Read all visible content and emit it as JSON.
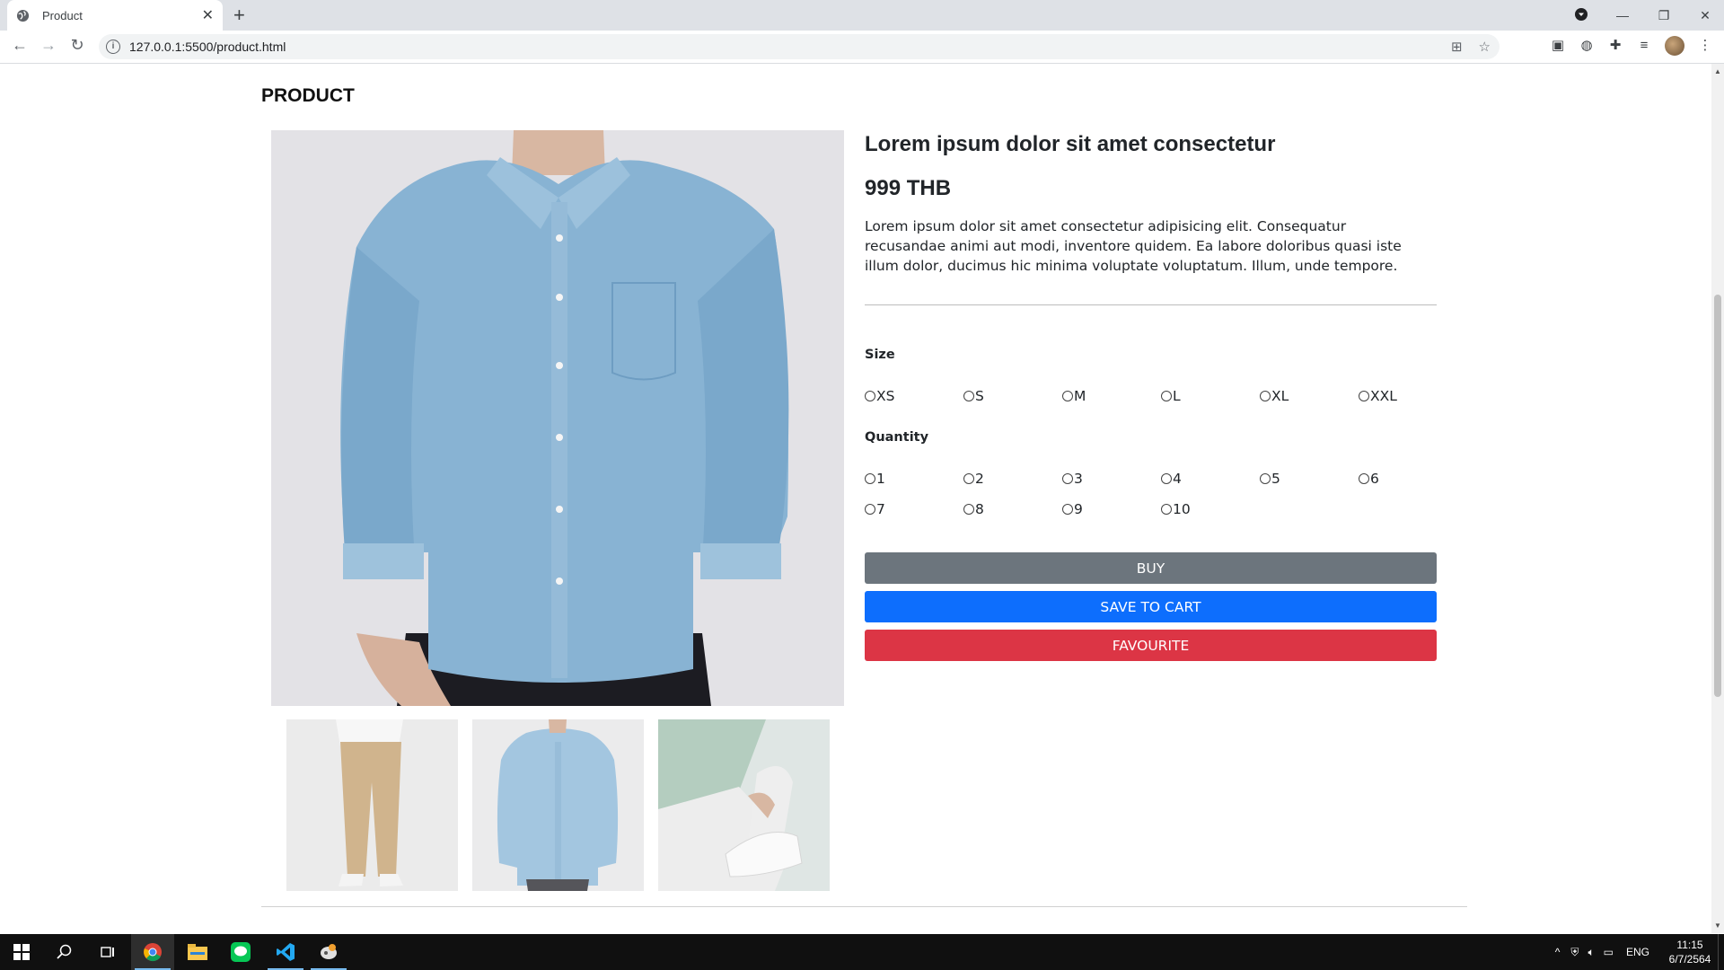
{
  "browser": {
    "tab_title": "Product",
    "tab_close": "✕",
    "new_tab": "+",
    "url": "127.0.0.1:5500/product.html",
    "window_controls": {
      "minimize": "—",
      "restore": "❐",
      "close": "✕"
    }
  },
  "page": {
    "heading": "PRODUCT",
    "product": {
      "title": "Lorem ipsum dolor sit amet consectetur",
      "price": "999 THB",
      "description": "Lorem ipsum dolor sit amet consectetur adipisicing elit. Consequatur recusandae animi aut modi, inventore quidem. Ea labore doloribus quasi iste illum dolor, ducimus hic minima voluptate voluptatum. Illum, unde tempore."
    },
    "size": {
      "label": "Size",
      "options": [
        "XS",
        "S",
        "M",
        "L",
        "XL",
        "XXL"
      ]
    },
    "quantity": {
      "label": "Quantity",
      "options": [
        "1",
        "2",
        "3",
        "4",
        "5",
        "6",
        "7",
        "8",
        "9",
        "10"
      ]
    },
    "buttons": {
      "buy": "BUY",
      "save_to_cart": "SAVE TO CART",
      "favourite": "FAVOURITE"
    },
    "button_colors": {
      "buy": "#6c757d",
      "save_to_cart": "#0d6efd",
      "favourite": "#dc3545"
    },
    "images": {
      "main": "denim-shirt-photo",
      "thumbnails": [
        "khaki-pants-photo",
        "denim-shirt-photo",
        "white-sneakers-photo"
      ]
    }
  },
  "taskbar": {
    "language": "ENG",
    "time": "11:15",
    "date": "6/7/2564",
    "apps": [
      "start-icon",
      "search-icon",
      "task-view-icon",
      "chrome-icon",
      "file-explorer-icon",
      "line-icon",
      "vscode-icon",
      "app-icon"
    ]
  }
}
